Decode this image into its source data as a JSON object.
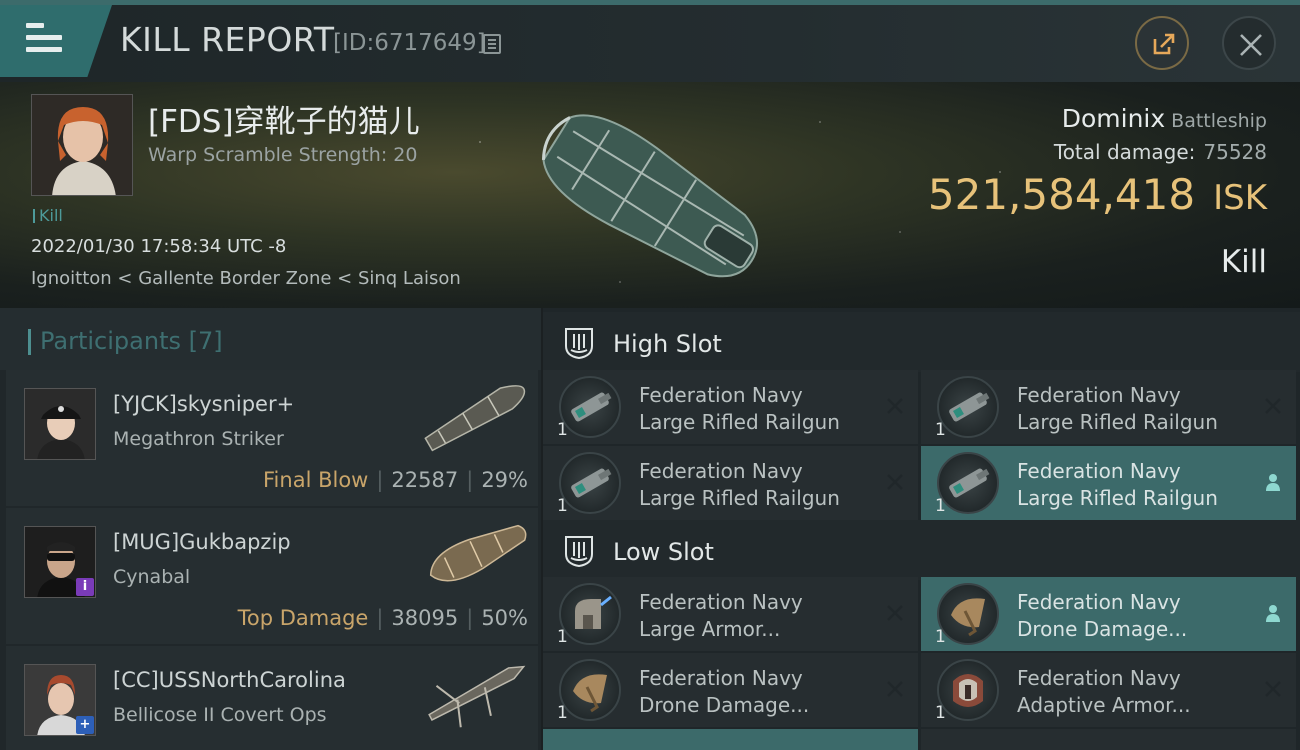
{
  "header": {
    "title": "KILL REPORT",
    "report_id": "[ID:6717649]"
  },
  "victim": {
    "name": "[FDS]穿靴子的猫儿",
    "warp_scramble": "Warp Scramble Strength: 20",
    "kill_tag": "Kill",
    "time": "2022/01/30 17:58:34 UTC -8",
    "location": "Ignoitton < Gallente Border Zone < Sinq Laison",
    "ship": "Dominix",
    "ship_class": "Battleship",
    "total_damage_label": "Total damage:",
    "total_damage": "75528",
    "isk_value": "521,584,418",
    "isk_unit": "ISK",
    "status": "Kill"
  },
  "participants": {
    "title": "Participants [7]",
    "items": [
      {
        "name": "[YJCK]skysniper+",
        "ship": "Megathron Striker",
        "tag": "Final Blow",
        "damage": "22587",
        "percent": "29%",
        "badge": ""
      },
      {
        "name": "[MUG]Gukbapzip",
        "ship": "Cynabal",
        "tag": "Top Damage",
        "damage": "38095",
        "percent": "50%",
        "badge": "i"
      },
      {
        "name": "[CC]USSNorthCarolina",
        "ship": "Bellicose II Covert Ops",
        "tag": "",
        "damage": "",
        "percent": "",
        "badge": "+"
      }
    ]
  },
  "fitting": {
    "high_slot_label": "High Slot",
    "low_slot_label": "Low Slot",
    "high_slot": [
      {
        "line1": "Federation Navy",
        "line2": "Large Rifled Railgun",
        "qty": "1",
        "state": "destroyed"
      },
      {
        "line1": "Federation Navy",
        "line2": "Large Rifled Railgun",
        "qty": "1",
        "state": "destroyed"
      },
      {
        "line1": "Federation Navy",
        "line2": "Large Rifled Railgun",
        "qty": "1",
        "state": "destroyed"
      },
      {
        "line1": "Federation Navy",
        "line2": "Large Rifled Railgun",
        "qty": "1",
        "state": "dropped"
      }
    ],
    "low_slot": [
      {
        "line1": "Federation Navy",
        "line2": "Large Armor...",
        "qty": "1",
        "state": "destroyed"
      },
      {
        "line1": "Federation Navy",
        "line2": "Drone Damage...",
        "qty": "1",
        "state": "dropped"
      },
      {
        "line1": "Federation Navy",
        "line2": "Drone Damage...",
        "qty": "1",
        "state": "destroyed"
      },
      {
        "line1": "Federation Navy",
        "line2": "Adaptive Armor...",
        "qty": "1",
        "state": "destroyed"
      }
    ]
  },
  "icons": {
    "menu": "menu-icon",
    "copy": "copy-icon",
    "share": "share-icon",
    "close": "close-icon",
    "slot": "slot-icon",
    "destroyed": "destroyed-x-icon",
    "dropped": "dropped-person-icon"
  },
  "colors": {
    "accent": "#2f6d6d",
    "isk": "#e7c27a",
    "tag": "#c9a56a",
    "dropped_bg": "#3c6a6a"
  }
}
